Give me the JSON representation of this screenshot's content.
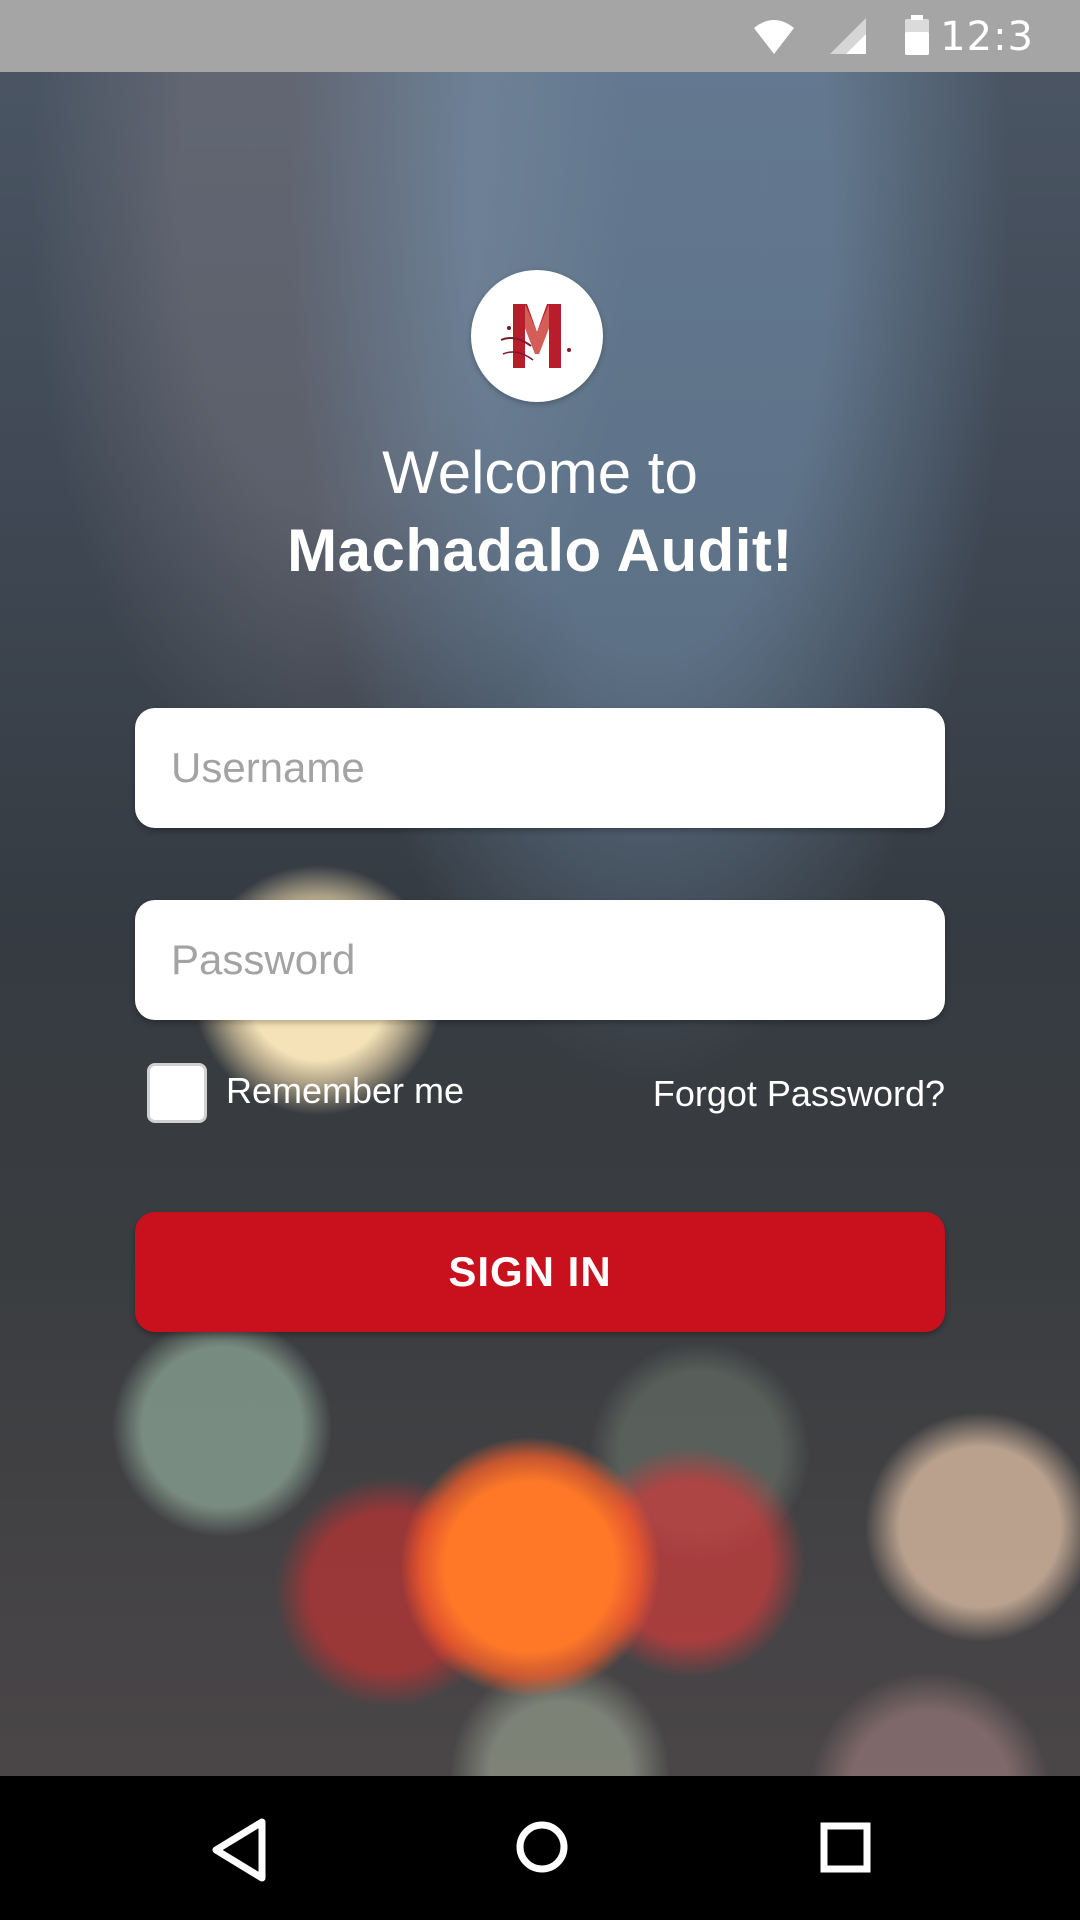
{
  "status_bar": {
    "time": "12:3",
    "icons": [
      "wifi-icon",
      "cell-signal-icon",
      "battery-icon"
    ]
  },
  "logo": {
    "letter": "M",
    "accent": "#c8111d"
  },
  "welcome": {
    "line1": "Welcome to",
    "line2": "Machadalo Audit!"
  },
  "form": {
    "username": {
      "placeholder": "Username",
      "value": ""
    },
    "password": {
      "placeholder": "Password",
      "value": ""
    },
    "remember_label": "Remember me",
    "remember_checked": false,
    "forgot_label": "Forgot Password?",
    "signin_label": "SIGN IN"
  },
  "colors": {
    "primary": "#c8111d",
    "status_bar": "#a6a5a6",
    "nav_bar": "#000000"
  },
  "nav_bar": {
    "icons": [
      "back-icon",
      "home-icon",
      "recents-icon"
    ]
  }
}
